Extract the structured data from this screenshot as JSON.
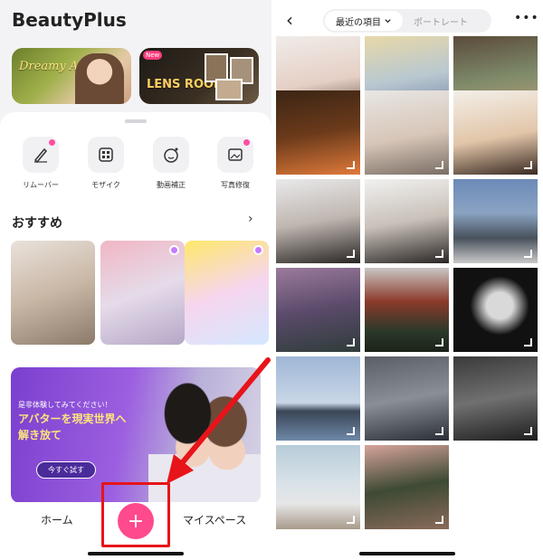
{
  "left": {
    "app_title": "BeautyPlus",
    "banners": [
      {
        "label": "Dreamy Anime"
      },
      {
        "label": "LENS ROOM",
        "badge": "New"
      }
    ],
    "tools": [
      {
        "label": "リムーバー",
        "icon": "eraser-icon"
      },
      {
        "label": "モザイク",
        "icon": "mosaic-icon"
      },
      {
        "label": "動画補正",
        "icon": "face-retouch-icon"
      },
      {
        "label": "写真修復",
        "icon": "photo-restore-icon"
      }
    ],
    "recommend_title": "おすすめ",
    "recommend_arrow": "›",
    "promo": {
      "line1": "是非体験してみてください！",
      "line2": "アバターを現実世界へ",
      "line3": "解き放て",
      "button": "今すぐ試す"
    },
    "nav": {
      "home": "ホーム",
      "add": "+",
      "my_space": "マイスペース"
    }
  },
  "right": {
    "back": "‹",
    "tabs": {
      "active": "最近の項目",
      "inactive": "ポートレート"
    },
    "more": "•••",
    "photos": [
      {
        "desc": "portrait-glasses"
      },
      {
        "desc": "dessert-bowl"
      },
      {
        "desc": "shop-shelves"
      },
      {
        "desc": "drink-bar"
      },
      {
        "desc": "portrait-blonde"
      },
      {
        "desc": "portrait-blonde-2"
      },
      {
        "desc": "portrait-short-hair"
      },
      {
        "desc": "portrait-beanie"
      },
      {
        "desc": "city-building"
      },
      {
        "desc": "flower-tree"
      },
      {
        "desc": "temple-roof"
      },
      {
        "desc": "shadow-figure"
      },
      {
        "desc": "waterfront-skyline"
      },
      {
        "desc": "street-crossing"
      },
      {
        "desc": "shadow-street"
      },
      {
        "desc": "woman-building"
      },
      {
        "desc": "woman-shutter"
      }
    ]
  },
  "colors": {
    "accent": "#ff4a8d",
    "highlight": "#e7141a"
  }
}
